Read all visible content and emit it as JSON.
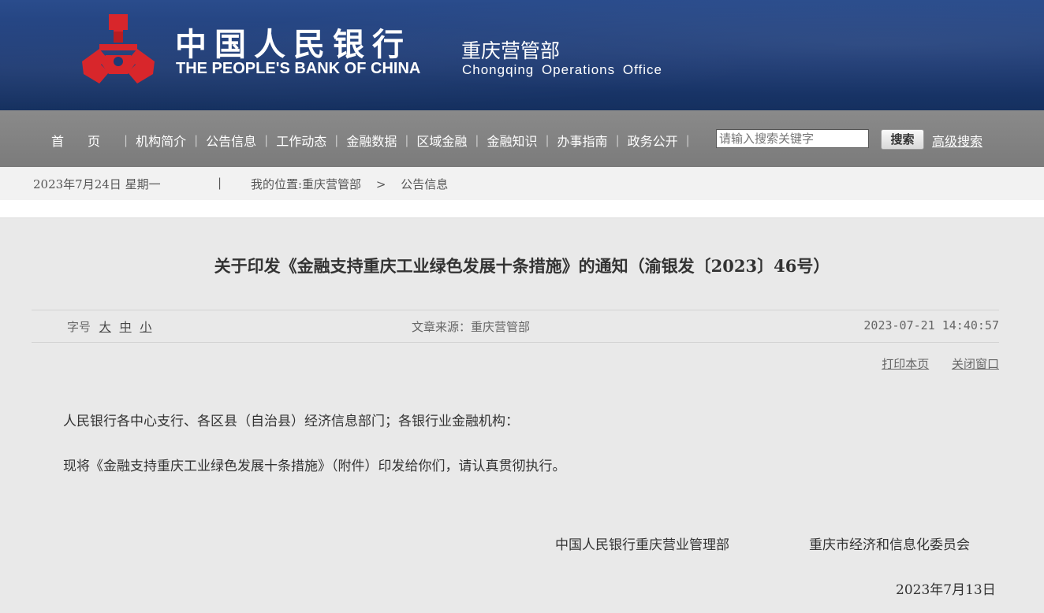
{
  "header": {
    "bank_name_cn": "中国人民银行",
    "bank_name_en": "THE PEOPLE'S BANK OF CHINA",
    "office_cn": "重庆营管部",
    "office_en": "Chongqing Operations Office",
    "logo_color": "#d8262b"
  },
  "nav": {
    "items": [
      "首页",
      "机构简介",
      "公告信息",
      "工作动态",
      "金融数据",
      "区域金融",
      "金融知识",
      "办事指南",
      "政务公开"
    ],
    "search_placeholder": "请输入搜索关键字",
    "search_button": "搜索",
    "advanced_search": "高级搜索"
  },
  "status": {
    "date": "2023年7月24日  星期一",
    "separator": "|",
    "location_label": "我的位置:重庆营管部",
    "crumb_sep": ">",
    "current": "公告信息"
  },
  "article": {
    "title": "关于印发《金融支持重庆工业绿色发展十条措施》的通知（渝银发〔2023〕46号）",
    "font_label": "字号",
    "font_sizes": [
      "大",
      "中",
      "小"
    ],
    "source": "文章来源：重庆营管部",
    "timestamp": "2023-07-21 14:40:57",
    "print": "打印本页",
    "close": "关闭窗口",
    "salutation": "人民银行各中心支行、各区县（自治县）经济信息部门；各银行业金融机构：",
    "body": "现将《金融支持重庆工业绿色发展十条措施》（附件）印发给你们，请认真贯彻执行。",
    "signatory_1": "中国人民银行重庆营业管理部",
    "signatory_2": "重庆市经济和信息化委员会",
    "sign_date": "2023年7月13日"
  }
}
